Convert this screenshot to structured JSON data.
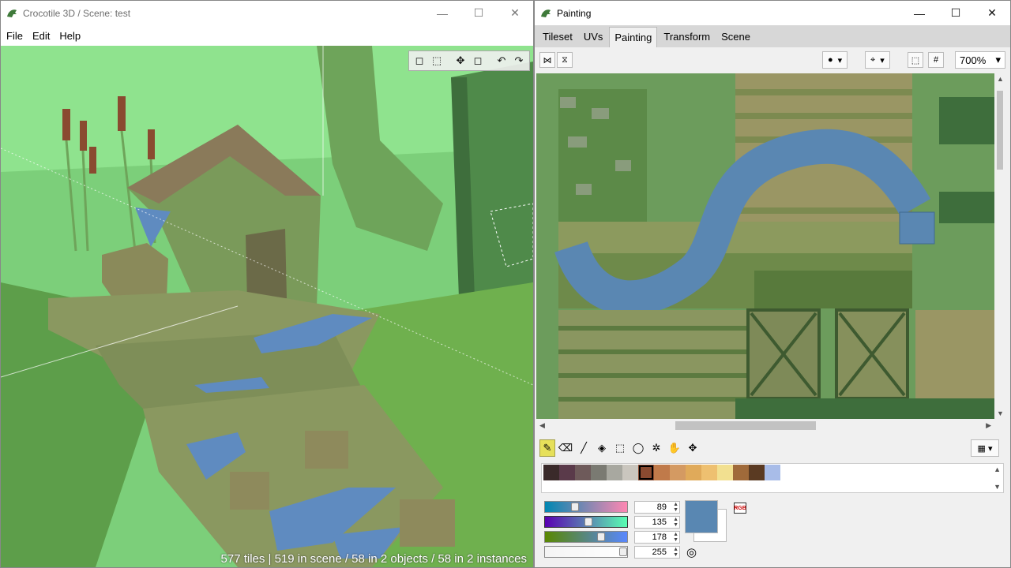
{
  "left_window": {
    "title": "Crocotile 3D / Scene: test",
    "controls": {
      "minimize": "—",
      "maximize": "☐",
      "close": "✕"
    },
    "menu": [
      "File",
      "Edit",
      "Help"
    ],
    "viewport_tools": [
      "◻",
      "⬚",
      "✥",
      "◻",
      "↶",
      "↷"
    ],
    "status": "577 tiles | 519 in scene / 58 in 2 objects / 58 in 2 instances"
  },
  "right_window": {
    "title": "Painting",
    "controls": {
      "minimize": "—",
      "maximize": "☐",
      "close": "✕"
    },
    "tabs": [
      "Tileset",
      "UVs",
      "Painting",
      "Transform",
      "Scene"
    ],
    "active_tab": "Painting",
    "zoom": "700%",
    "tools": [
      "pencil",
      "eraser",
      "line",
      "fill",
      "rect-select",
      "lasso",
      "magic-wand",
      "hand",
      "move-select"
    ],
    "palette": [
      "#3a2a2a",
      "#5a3a4a",
      "#6e5a5a",
      "#7a7a72",
      "#a8a8a0",
      "#cac6be",
      "#8a4a30",
      "#c07a4a",
      "#d49a62",
      "#e0aa5a",
      "#eec070",
      "#f2e090",
      "#a06a3a",
      "#5a3a22",
      "#a8bce8"
    ],
    "selected_swatch": 6,
    "color": {
      "r": "89",
      "g": "135",
      "b": "178",
      "a": "255",
      "hex": "#5987b2"
    },
    "slider_fractions": {
      "r": 0.35,
      "g": 0.53,
      "b": 0.7,
      "a": 1.0
    }
  }
}
